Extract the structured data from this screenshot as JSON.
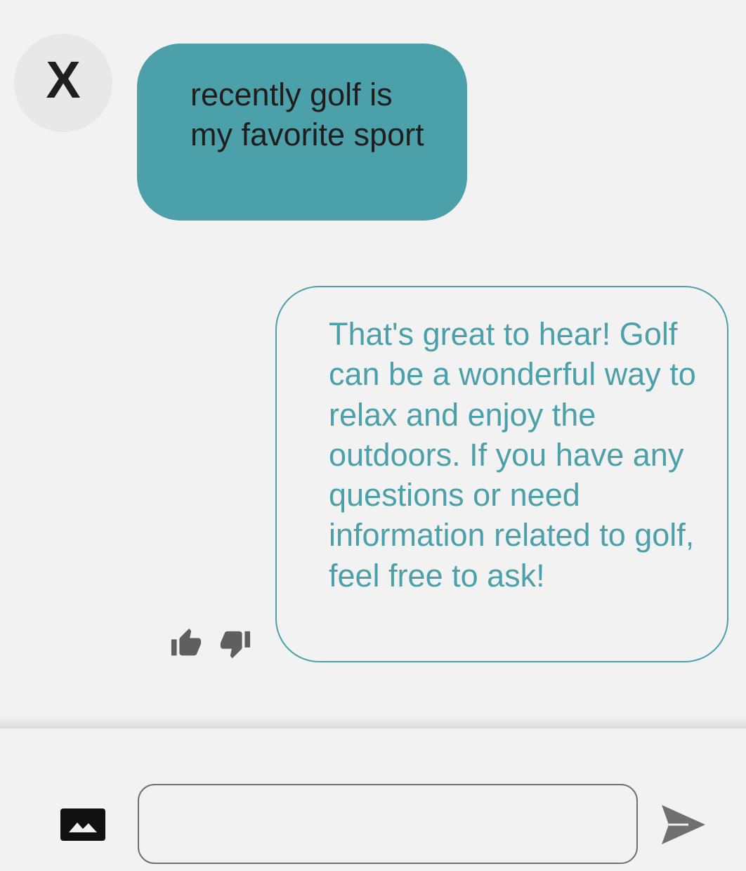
{
  "chat": {
    "avatar_letter": "X",
    "messages": [
      {
        "role": "user",
        "text": "recently golf is my favorite sport"
      },
      {
        "role": "assistant",
        "text": "That's great to hear! Golf can be a wonderful way to relax and enjoy the outdoors. If you have any questions or need information related to golf, feel free to ask!"
      }
    ],
    "feedback_icons": [
      "thumbs-up-icon",
      "thumbs-down-icon"
    ]
  },
  "composer": {
    "input_value": "",
    "placeholder": "",
    "attach_icon": "image-icon",
    "send_icon": "send-icon"
  },
  "colors": {
    "accent": "#4ba0a9",
    "background": "#f2f2f2",
    "icon_gray": "#5f5f5f"
  }
}
